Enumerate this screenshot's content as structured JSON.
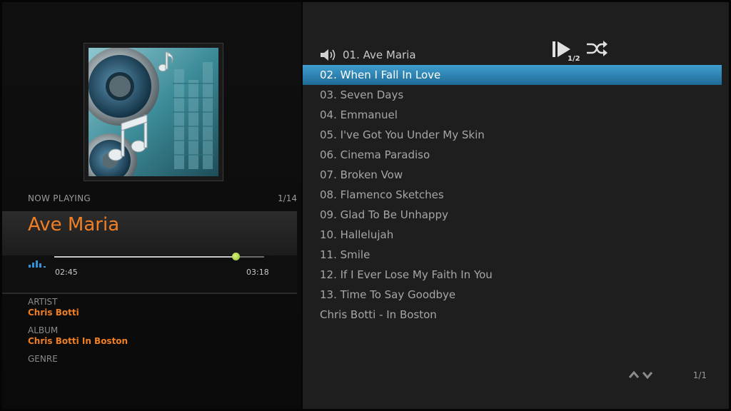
{
  "now_playing": {
    "label": "NOW PLAYING",
    "track_position": "1/14",
    "title": "Ave Maria",
    "elapsed": "02:45",
    "duration": "03:18",
    "progress": 0.865,
    "artist_label": "ARTIST",
    "artist": "Chris Botti",
    "album_label": "ALBUM",
    "album": "Chris Botti In Boston",
    "genre_label": "GENRE"
  },
  "playlist": {
    "items": [
      "01. Ave Maria",
      "02. When I Fall In Love",
      "03. Seven Days",
      "04. Emmanuel",
      "05. I've Got You Under My Skin",
      "06. Cinema Paradiso",
      "07. Broken Vow",
      "08. Flamenco Sketches",
      "09. Glad To Be Unhappy",
      "10. Hallelujah",
      "11. Smile",
      "12. If I Ever Lose My Faith In You",
      "13. Time To Say Goodbye",
      "Chris Botti - In Boston"
    ],
    "playing_index": 0,
    "selected_index": 1,
    "page_indicator": "1/1",
    "play_mode_label": "1/2"
  },
  "colors": {
    "accent": "#f07f24",
    "selection": "#2a86b8",
    "progress_knob": "#9acd32"
  },
  "icons": [
    "speaker-icon",
    "play-pause-icon",
    "shuffle-icon",
    "equalizer-icon",
    "scroll-up-icon",
    "scroll-down-icon",
    "album-art"
  ]
}
